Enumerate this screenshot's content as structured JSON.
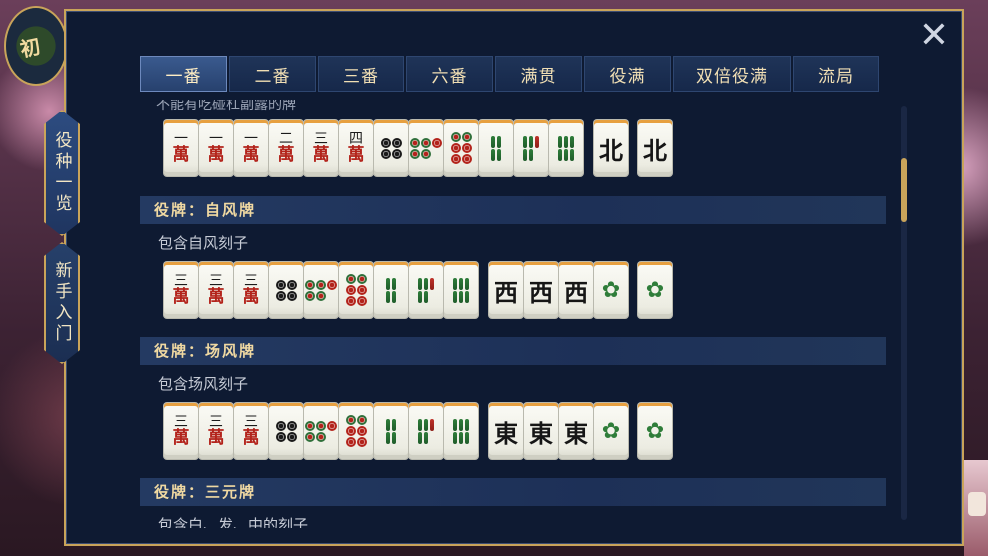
{
  "side_tabs": [
    {
      "label": "役种一览",
      "active": true
    },
    {
      "label": "新手入门",
      "active": false
    }
  ],
  "logo_text": "初",
  "close_label": "✕",
  "tabs": [
    {
      "label": "一番",
      "active": true
    },
    {
      "label": "二番",
      "active": false
    },
    {
      "label": "三番",
      "active": false
    },
    {
      "label": "六番",
      "active": false
    },
    {
      "label": "满贯",
      "active": false
    },
    {
      "label": "役满",
      "active": false
    },
    {
      "label": "双倍役满",
      "active": false
    },
    {
      "label": "流局",
      "active": false
    }
  ],
  "partial_top_text": "不能有吃碰杠副露的牌",
  "first_hand": {
    "tiles": [
      "1m",
      "1m",
      "1m",
      "2m",
      "3m",
      "4m",
      "4p",
      "5p",
      "6p",
      "4s",
      "5s",
      "6s",
      "N",
      "N"
    ]
  },
  "sections": [
    {
      "title": "役牌：自风牌",
      "desc": "包含自风刻子",
      "tiles": [
        "3m",
        "3m",
        "3m",
        "4p",
        "5p",
        "6p",
        "4s",
        "5s",
        "6s",
        "W",
        "W",
        "W",
        "F",
        "F"
      ]
    },
    {
      "title": "役牌：场风牌",
      "desc": "包含场风刻子",
      "tiles": [
        "3m",
        "3m",
        "3m",
        "4p",
        "5p",
        "6p",
        "4s",
        "5s",
        "6s",
        "E",
        "E",
        "E",
        "F",
        "F"
      ]
    },
    {
      "title": "役牌：三元牌",
      "desc": "包含白、发、中的刻子"
    }
  ],
  "tile_glyphs": {
    "num": {
      "1": "一",
      "2": "二",
      "3": "三",
      "4": "四"
    },
    "wan": "萬",
    "winds": {
      "N": "北",
      "W": "西",
      "E": "東"
    }
  },
  "colors": {
    "gold": "#c9a45a",
    "panel": "#0e1a32",
    "tab_text": "#f1dfb4",
    "red": "#b3231b",
    "green": "#2e7d3a"
  }
}
